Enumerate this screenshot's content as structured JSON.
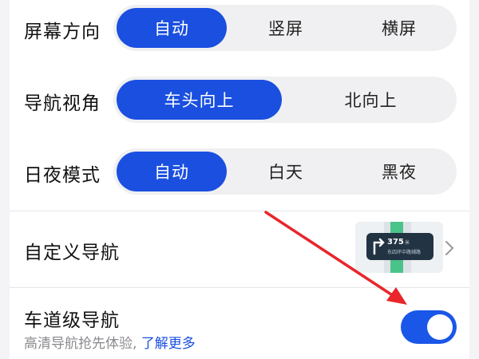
{
  "settings": {
    "screen_orientation": {
      "label": "屏幕方向",
      "options": [
        "自动",
        "竖屏",
        "横屏"
      ],
      "selected": "自动"
    },
    "nav_view": {
      "label": "导航视角",
      "options": [
        "车头向上",
        "北向上"
      ],
      "selected": "车头向上"
    },
    "day_night": {
      "label": "日夜模式",
      "options": [
        "自动",
        "白天",
        "黑夜"
      ],
      "selected": "自动"
    },
    "custom_nav": {
      "label": "自定义导航",
      "preview": {
        "distance": "375",
        "unit": "米",
        "road": "东四环中路辅路"
      }
    },
    "lane_nav": {
      "label": "车道级导航",
      "subtitle": "高清导航抢先体验,",
      "link": "了解更多",
      "enabled": true
    }
  },
  "colors": {
    "accent": "#1a4fe0",
    "annotation_arrow": "#e8262b"
  },
  "icons": {
    "chevron": "chevron-right-icon",
    "turn": "turn-left-arrow-icon"
  }
}
